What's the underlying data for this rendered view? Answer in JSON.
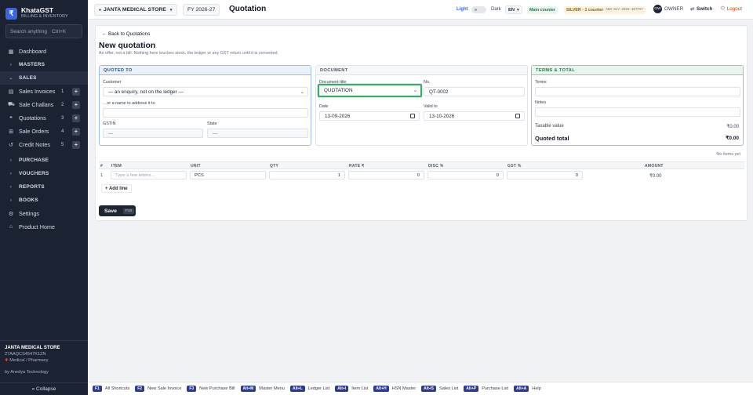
{
  "brand": {
    "logo": "₹",
    "name": "KhataGST",
    "subtitle": "BILLING & INVENTORY"
  },
  "sidebar": {
    "search_label": "Search anything",
    "search_shortcut": "Ctrl+K",
    "items": [
      {
        "label": "Dashboard",
        "icon": "dashboard-icon",
        "glyph": "▦"
      },
      {
        "label": "MASTERS",
        "icon": "chevron-right-icon",
        "glyph": "›"
      },
      {
        "label": "SALES",
        "icon": "chevron-down-icon",
        "glyph": "⌄"
      },
      {
        "label": "Sales Invoices",
        "icon": "invoice-icon",
        "glyph": "▤",
        "count": "1"
      },
      {
        "label": "Sale Challans",
        "icon": "truck-icon",
        "glyph": "⛟",
        "count": "2"
      },
      {
        "label": "Quotations",
        "icon": "quote-icon",
        "glyph": "❝",
        "count": "3"
      },
      {
        "label": "Sale Orders",
        "icon": "cart-icon",
        "glyph": "⊞",
        "count": "4"
      },
      {
        "label": "Credit Notes",
        "icon": "credit-note-icon",
        "glyph": "↺",
        "count": "5"
      },
      {
        "label": "PURCHASE",
        "icon": "chevron-right-icon",
        "glyph": "›"
      },
      {
        "label": "VOUCHERS",
        "icon": "chevron-right-icon",
        "glyph": "›"
      },
      {
        "label": "REPORTS",
        "icon": "chevron-right-icon",
        "glyph": "›"
      },
      {
        "label": "BOOKS",
        "icon": "chevron-right-icon",
        "glyph": "›"
      },
      {
        "label": "Settings",
        "icon": "gear-icon",
        "glyph": "⚙"
      },
      {
        "label": "Product Home",
        "icon": "home-icon",
        "glyph": "⌂"
      }
    ],
    "plus": "+",
    "footer": {
      "store": "JANTA MEDICAL STORE",
      "gstin": "27AAQCS4547K1ZN",
      "category": "Medical / Pharmacy",
      "by": "by Anedya Technology"
    },
    "collapse": "« Collapse"
  },
  "topbar": {
    "store_selector": "JANTA MEDICAL STORE",
    "fy": "FY 2026-27",
    "title": "Quotation",
    "theme_light": "Light",
    "theme_dark": "Dark",
    "lang": "EN",
    "counter": "Main counter",
    "plan": "SILVER · 1 counter",
    "license": "ANO-SLV-2026-4E7F97",
    "role_badge": "OW",
    "role": "OWNER",
    "switch": "Switch",
    "logout": "Logout"
  },
  "form": {
    "back": "← Back to Quotations",
    "heading": "New quotation",
    "subtitle": "An offer, not a bill. Nothing here touches stock, the ledger or any GST return until it is converted.",
    "quoted_to": {
      "header": "QUOTED TO",
      "customer_label": "Customer",
      "customer_value": "— an enquiry, not on the ledger —",
      "address_label": "…or a name to address it to",
      "address_value": "",
      "gstin_label": "GSTIN",
      "gstin_value": "—",
      "state_label": "State",
      "state_value": "—"
    },
    "document": {
      "header": "DOCUMENT",
      "title_label": "Document title",
      "title_value": "QUOTATION",
      "no_label": "No.",
      "no_value": "QT-0002",
      "date_label": "Date",
      "date_value": "13-09-2026",
      "valid_label": "Valid to",
      "valid_value": "13-10-2026"
    },
    "terms": {
      "header": "TERMS & TOTAL",
      "terms_label": "Terms",
      "notes_label": "Notes",
      "taxable_label": "Taxable value",
      "taxable_value": "₹0.00",
      "total_label": "Quoted total",
      "total_value": "₹0.00"
    },
    "items": {
      "no_items": "No items yet",
      "columns": [
        "#",
        "ITEM",
        "UNIT",
        "QTY",
        "RATE ₹",
        "DISC %",
        "GST %",
        "AMOUNT"
      ],
      "row": {
        "no": "1",
        "item_placeholder": "Type a few letters…",
        "unit": "PCS",
        "qty": "1",
        "rate": "0",
        "disc": "0",
        "gst": "0",
        "amount": "₹0.00"
      },
      "add_line": "+ Add line"
    },
    "save": "Save",
    "save_key": "F10"
  },
  "shortcuts": [
    {
      "key": "F1",
      "label": "All Shortcuts"
    },
    {
      "key": "F2",
      "label": "New Sale Invoice"
    },
    {
      "key": "F3",
      "label": "New Purchase Bill"
    },
    {
      "key": "Alt+M",
      "label": "Master Menu"
    },
    {
      "key": "Alt+L",
      "label": "Ledger List"
    },
    {
      "key": "Alt+I",
      "label": "Item List"
    },
    {
      "key": "Alt+H",
      "label": "HSN Master"
    },
    {
      "key": "Alt+S",
      "label": "Sales List"
    },
    {
      "key": "Alt+P",
      "label": "Purchase List"
    },
    {
      "key": "Alt+A",
      "label": "Help"
    }
  ],
  "colors": {
    "sidebar_bg": "#1b2232",
    "accent": "#3f66d8",
    "focus": "#3fa865",
    "shortcut_key": "#2f3b8c"
  }
}
